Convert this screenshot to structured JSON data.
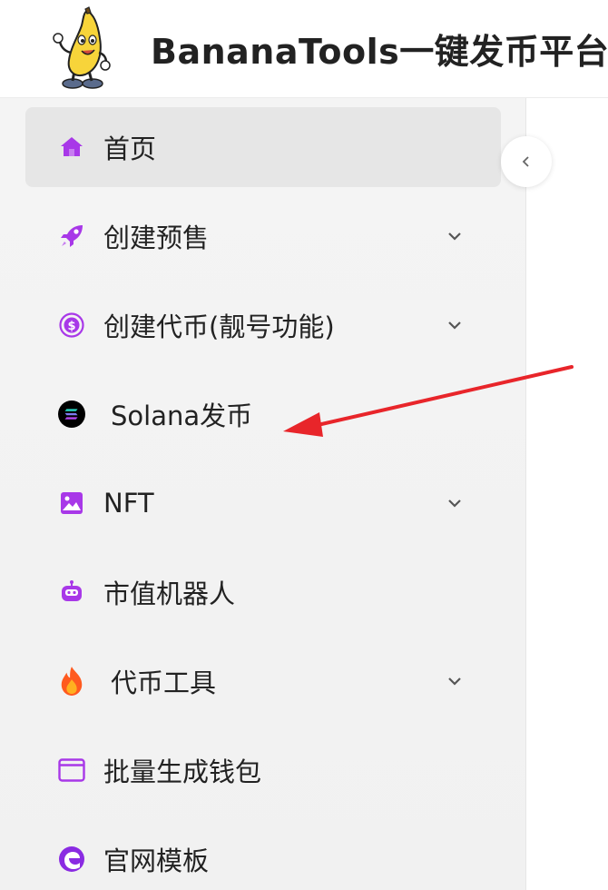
{
  "header": {
    "title": "BananaTools一键发币平台",
    "logo_icon": "banana-mascot-logo"
  },
  "sidebar": {
    "active_index": 0,
    "items": [
      {
        "label": "首页",
        "icon": "home-icon",
        "icon_color": "#a838e8",
        "has_submenu": false
      },
      {
        "label": "创建预售",
        "icon": "rocket-icon",
        "icon_color": "#a838e8",
        "has_submenu": true
      },
      {
        "label": "创建代币(靓号功能)",
        "icon": "dollar-coin-icon",
        "icon_color": "#a838e8",
        "has_submenu": true
      },
      {
        "label": "Solana发币",
        "icon": "solana-icon",
        "icon_color": "#000000",
        "has_submenu": false
      },
      {
        "label": "NFT",
        "icon": "image-icon",
        "icon_color": "#a838e8",
        "has_submenu": true
      },
      {
        "label": "市值机器人",
        "icon": "robot-icon",
        "icon_color": "#a838e8",
        "has_submenu": false
      },
      {
        "label": "代币工具",
        "icon": "fire-icon",
        "icon_color": "#ff5a1f",
        "has_submenu": true
      },
      {
        "label": "批量生成钱包",
        "icon": "window-icon",
        "icon_color": "#a838e8",
        "has_submenu": false
      },
      {
        "label": "官网模板",
        "icon": "edge-logo-icon",
        "icon_color": "#8a2be2",
        "has_submenu": false
      }
    ]
  },
  "collapse_button": {
    "icon": "chevron-left-icon"
  },
  "annotation": {
    "type": "red-arrow",
    "color": "#e8252a",
    "points_to": "Solana发币"
  }
}
